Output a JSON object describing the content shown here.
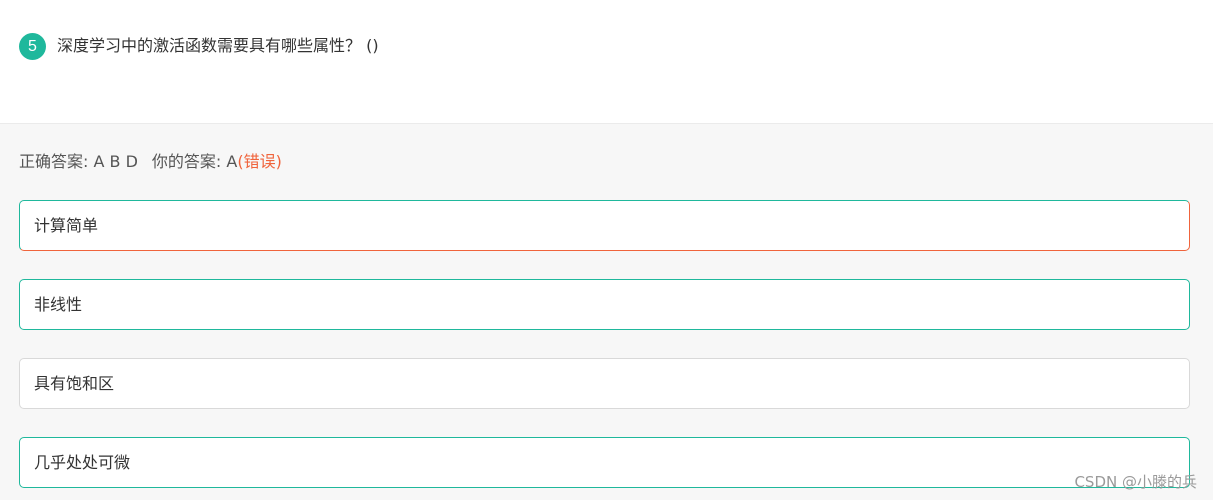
{
  "question": {
    "number": "5",
    "text": "深度学习中的激活函数需要具有哪些属性？ ()"
  },
  "result": {
    "correct_label": "正确答案: A B D",
    "your_label": "你的答案: A",
    "status": "(错误)"
  },
  "options": [
    {
      "label": "计算简单",
      "state": "correct-selected-wrong"
    },
    {
      "label": "非线性",
      "state": "correct"
    },
    {
      "label": "具有饱和区",
      "state": "neutral"
    },
    {
      "label": "几乎处处可微",
      "state": "correct"
    }
  ],
  "watermark": "CSDN @小滕的兵",
  "colors": {
    "accent": "#1fb89c",
    "error": "#f0643c"
  }
}
